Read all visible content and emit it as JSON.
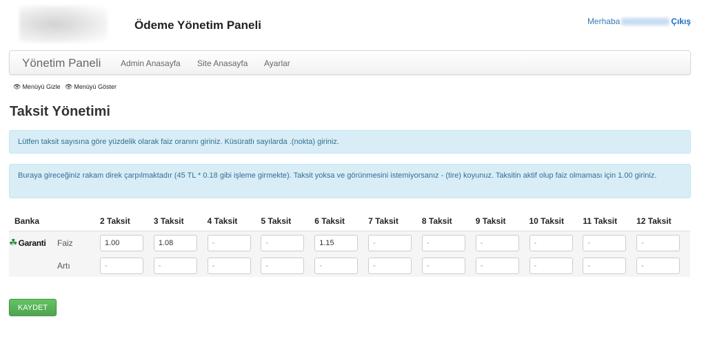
{
  "header": {
    "site_title": "Ödeme Yönetim Paneli",
    "greeting": "Merhaba",
    "logout": "Çıkış"
  },
  "navbar": {
    "brand": "Yönetim Paneli",
    "links": [
      "Admin Anasayfa",
      "Site Anasayfa",
      "Ayarlar"
    ]
  },
  "menu_toggles": {
    "hide": "Menüyü Gizle",
    "show": "Menüyü Göster"
  },
  "page": {
    "title": "Taksit Yönetimi"
  },
  "alerts": [
    "Lütfen taksit sayısına göre yüzdelik olarak faiz oranını giriniz. Küsüratlı sayılarda .(nokta) giriniz.",
    "Buraya gireceğiniz rakam direk çarpılmaktadır (45 TL * 0.18 gibi işleme girmekte). Taksit yoksa ve görünmesini istemiyorsanız - (tire) koyunuz. Taksitin aktif olup faiz olmaması için 1.00 giriniz."
  ],
  "table": {
    "bank_header": "Banka",
    "installments": [
      "2 Taksit",
      "3 Taksit",
      "4 Taksit",
      "5 Taksit",
      "6 Taksit",
      "7 Taksit",
      "8 Taksit",
      "9 Taksit",
      "10 Taksit",
      "11 Taksit",
      "12 Taksit"
    ],
    "bank_name": "Garanti",
    "rows": [
      {
        "label": "Faiz",
        "values": [
          "1.00",
          "1.08",
          "",
          "",
          "1.15",
          "",
          "",
          "",
          "",
          "",
          ""
        ],
        "placeholder": "-"
      },
      {
        "label": "Artı",
        "values": [
          "",
          "",
          "",
          "",
          "",
          "",
          "",
          "",
          "",
          "",
          ""
        ],
        "placeholder": "-"
      }
    ]
  },
  "save_button": "KAYDET",
  "colors": {
    "accent": "#337ab7",
    "alert_bg": "#d9edf7",
    "alert_text": "#31708f",
    "success": "#5cb85c",
    "garanti_green": "#2a8a3e"
  }
}
